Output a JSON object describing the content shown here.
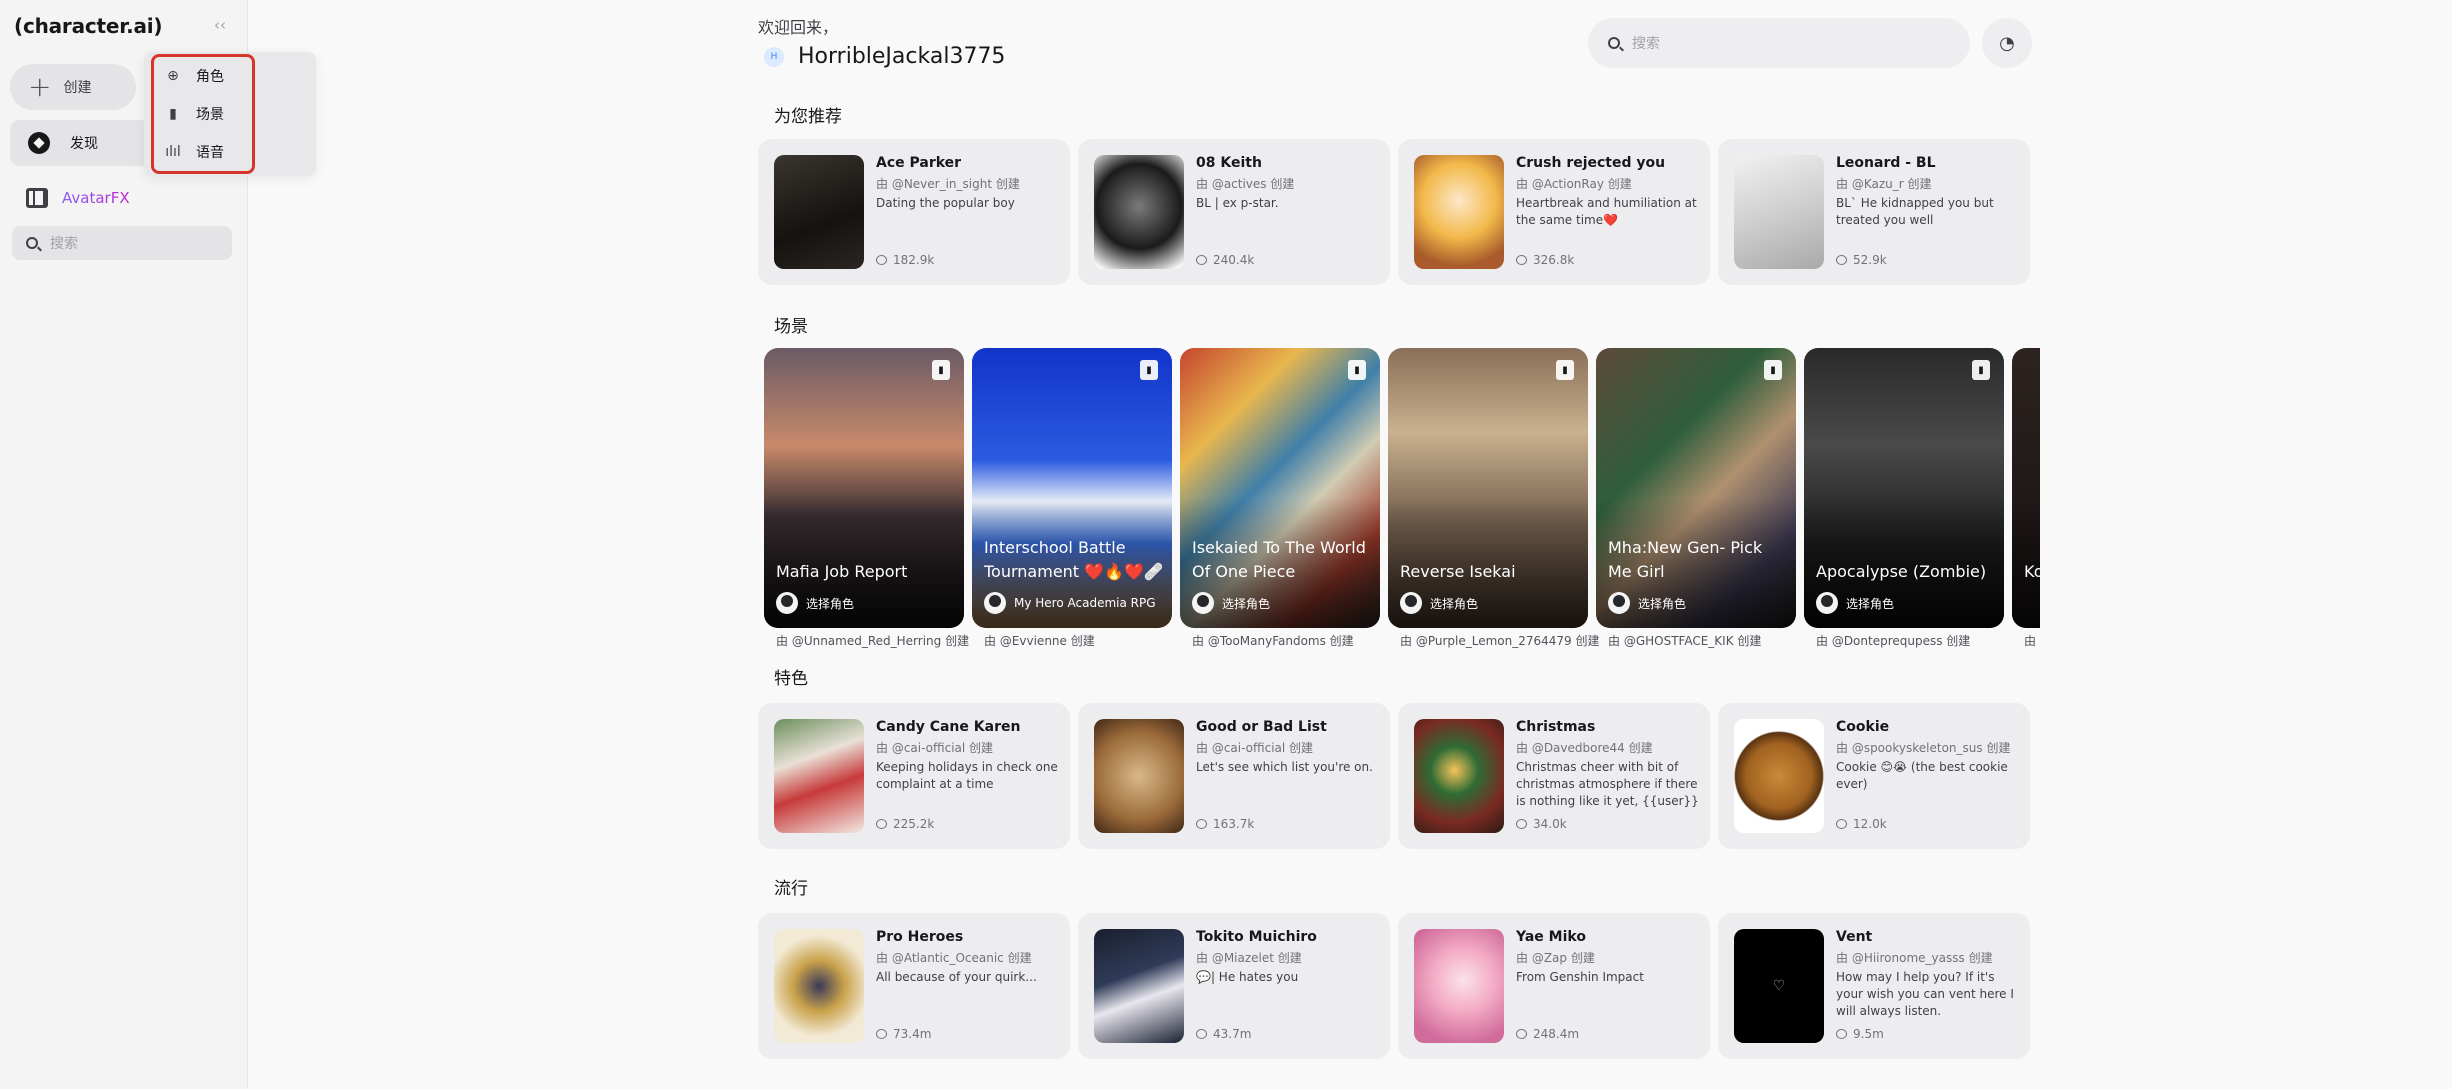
{
  "sidebar": {
    "logo": "(character.ai)",
    "collapse_icon": "double-chevron-left-icon",
    "create_label": "创建",
    "discover_label": "发现",
    "avatarfx_label": "AvatarFX",
    "search_placeholder": "搜索",
    "create_menu": [
      {
        "label": "角色",
        "icon": "character-icon"
      },
      {
        "label": "场景",
        "icon": "scene-book-icon"
      },
      {
        "label": "语音",
        "icon": "voice-wave-icon"
      }
    ]
  },
  "header": {
    "welcome": "欢迎回来，",
    "user_initial": "H",
    "username": "HorribleJackal3775",
    "search_placeholder": "搜索",
    "notification_icon": "notification-icon"
  },
  "sections": {
    "recommended": "为您推荐",
    "scenes": "场景",
    "featured": "特色",
    "popular": "流行"
  },
  "recommended": [
    {
      "title": "Ace Parker",
      "author": "由 @Never_in_sight 创建",
      "desc": "Dating the popular boy",
      "count": "182.9k"
    },
    {
      "title": "08 Keith",
      "author": "由 @actives 创建",
      "desc": "BL | ex p-star.",
      "count": "240.4k"
    },
    {
      "title": "Crush rejected you",
      "author": "由 @ActionRay 创建",
      "desc": "Heartbreak and humiliation at the same time❤️",
      "count": "326.8k"
    },
    {
      "title": "Leonard - BL",
      "author": "由 @Kazu_r 创建",
      "desc": "BL` He kidnapped you but treated you well",
      "count": "52.9k"
    }
  ],
  "scenes": [
    {
      "title": "Mafia Job Report",
      "pick": "选择角色",
      "author": "由 @Unnamed_Red_Herring 创建"
    },
    {
      "title": "Interschool Battle Tournament ❤️🔥❤️🩹",
      "pick": "My Hero Academia RPG",
      "author": "由 @Evvienne 创建"
    },
    {
      "title": "Isekaied To The World Of One Piece",
      "pick": "选择角色",
      "author": "由 @TooManyFandoms 创建"
    },
    {
      "title": "Reverse Isekai",
      "pick": "选择角色",
      "author": "由 @Purple_Lemon_2764479 创建"
    },
    {
      "title": "Mha:New Gen- Pick Me Girl",
      "pick": "选择角色",
      "author": "由 @GHOSTFACE_KIK 创建"
    },
    {
      "title": "Apocalypse (Zombie)",
      "pick": "选择角色",
      "author": "由 @Donteprequpess 创建"
    },
    {
      "title": "Ko",
      "pick": "",
      "author": "由 @"
    }
  ],
  "featured": [
    {
      "title": "Candy Cane Karen",
      "author": "由 @cai-official 创建",
      "desc": "Keeping holidays in check one complaint at a time",
      "count": "225.2k"
    },
    {
      "title": "Good or Bad List",
      "author": "由 @cai-official 创建",
      "desc": "Let's see which list you're on.",
      "count": "163.7k"
    },
    {
      "title": "Christmas",
      "author": "由 @Davedbore44 创建",
      "desc": "Christmas cheer with bit of christmas atmosphere if there is nothing like it yet, {{user}} at...",
      "count": "34.0k"
    },
    {
      "title": "Cookie",
      "author": "由 @spookyskeleton_sus 创建",
      "desc": "Cookie 😊😭 (the best cookie ever)",
      "count": "12.0k"
    }
  ],
  "popular": [
    {
      "title": "Pro Heroes",
      "author": "由 @Atlantic_Oceanic 创建",
      "desc": "All because of your quirk...",
      "count": "73.4m"
    },
    {
      "title": "Tokito Muichiro",
      "author": "由 @Miazelet 创建",
      "desc": "💬| He hates you",
      "count": "43.7m"
    },
    {
      "title": "Yae Miko",
      "author": "由 @Zap 创建",
      "desc": "From Genshin Impact",
      "count": "248.4m"
    },
    {
      "title": "Vent",
      "author": "由 @Hiironome_yasss 创建",
      "desc": "How may I help you? If it's your wish you can vent here I will always listen.",
      "count": "9.5m"
    }
  ],
  "colors": {
    "highlight_frame": "#d7352b",
    "avatarfx_gradient_start": "#8b5cf6",
    "avatarfx_gradient_end": "#c026d3"
  }
}
